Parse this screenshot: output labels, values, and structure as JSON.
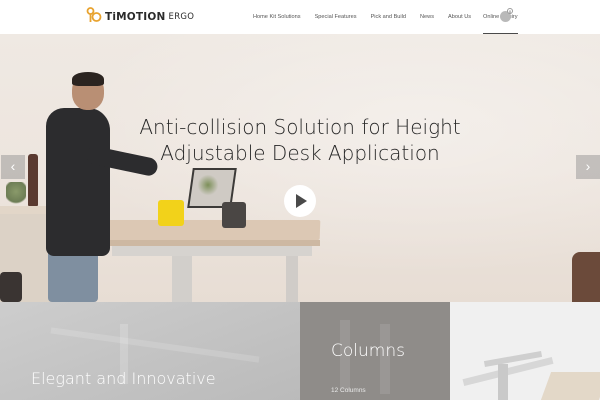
{
  "brand": {
    "name": "TiMOTION",
    "sub": "ERGO"
  },
  "nav": {
    "items": [
      {
        "label": "Home Kit Solutions"
      },
      {
        "label": "Special Features"
      },
      {
        "label": "Pick and Build"
      },
      {
        "label": "News"
      },
      {
        "label": "About Us"
      },
      {
        "label": "Online Inquiry"
      }
    ],
    "active_index": 5,
    "cart_count": "0"
  },
  "hero": {
    "title_line1": "Anti-collision Solution for Height",
    "title_line2": "Adjustable Desk Application",
    "prev_arrow": "‹",
    "next_arrow": "›"
  },
  "tiles": {
    "left_title": "Elegant and Innovative",
    "middle_title": "Columns",
    "middle_subtitle": "12 Columns"
  },
  "icons": [
    "logo-icon",
    "cart-icon",
    "play-icon",
    "chevron-left-icon",
    "chevron-right-icon"
  ],
  "colors": {
    "accent": "#e8a330",
    "text_dark": "#262626",
    "nav_text": "#555555"
  }
}
